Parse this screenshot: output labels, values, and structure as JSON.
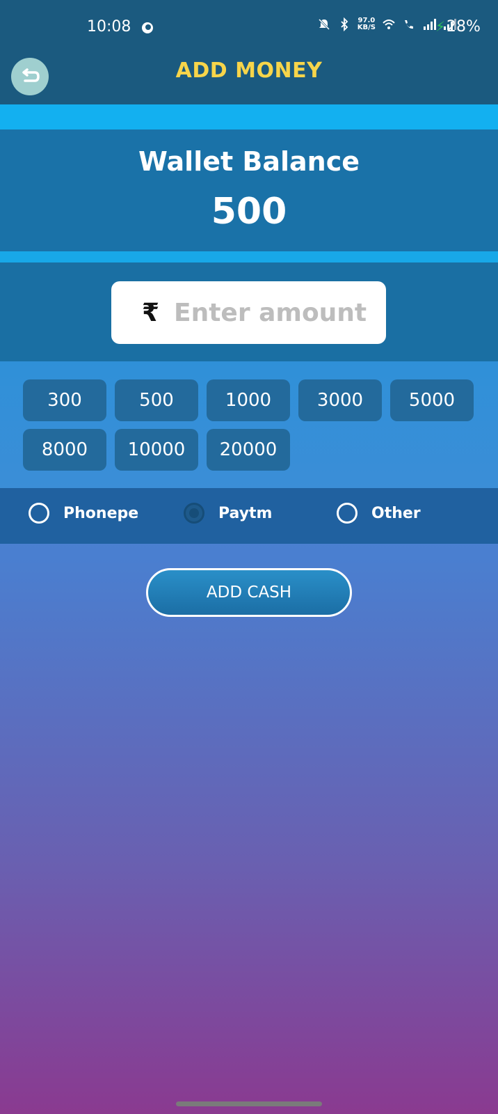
{
  "status_bar": {
    "time": "10:08",
    "net_speed_value": "97.0",
    "net_speed_unit": "KB/S",
    "battery": "28%"
  },
  "header": {
    "title": "ADD MONEY"
  },
  "wallet": {
    "label": "Wallet Balance",
    "balance": "500"
  },
  "amount_input": {
    "currency_symbol": "₹",
    "placeholder": "Enter amount",
    "value": ""
  },
  "quick_amounts": [
    "300",
    "500",
    "1000",
    "3000",
    "5000",
    "8000",
    "10000",
    "20000"
  ],
  "payment_methods": [
    {
      "label": "Phonepe",
      "selected": false
    },
    {
      "label": "Paytm",
      "selected": true
    },
    {
      "label": "Other",
      "selected": false
    }
  ],
  "add_cash_label": "ADD CASH",
  "colors": {
    "title": "#f7d54a",
    "header_bg": "#1b5a7f",
    "accent_stripe": "#13b0f0",
    "chip_bg": "#236a9c"
  }
}
